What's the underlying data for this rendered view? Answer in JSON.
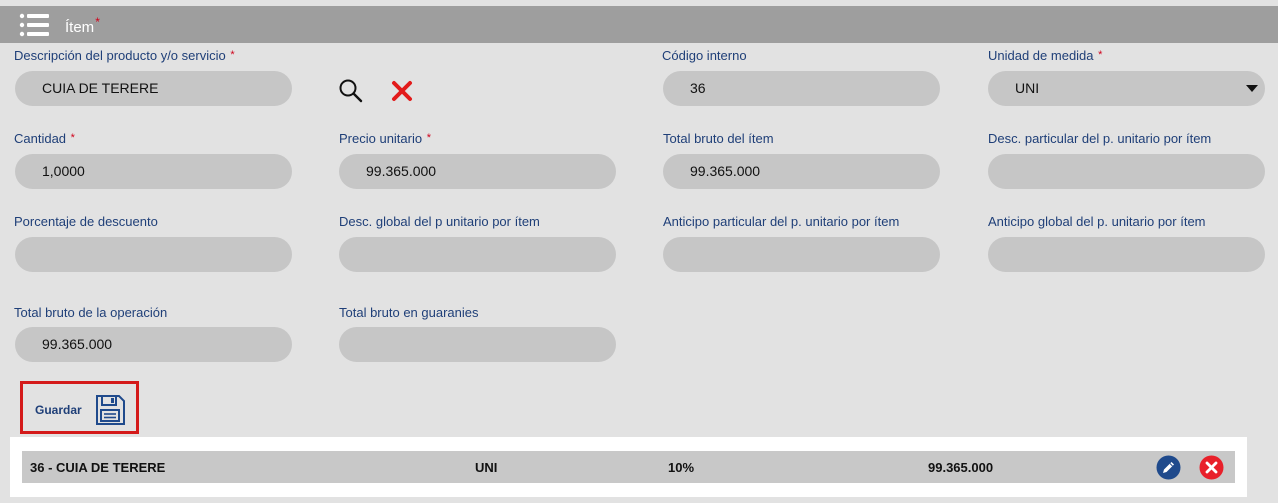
{
  "header": {
    "title": "Ítem",
    "required_mark": "*"
  },
  "fields": {
    "descripcion": {
      "label": "Descripción del producto y/o servicio",
      "required_mark": "*",
      "value": "CUIA DE TERERE"
    },
    "codigo": {
      "label": "Código interno",
      "value": "36"
    },
    "unidad": {
      "label": "Unidad de medida",
      "required_mark": "*",
      "value": "UNI"
    },
    "cantidad": {
      "label": "Cantidad",
      "required_mark": "*",
      "value": "1,0000"
    },
    "precio": {
      "label": "Precio unitario",
      "required_mark": "*",
      "value": "99.365.000"
    },
    "total_item": {
      "label": "Total bruto del ítem",
      "value": "99.365.000"
    },
    "desc_particular": {
      "label": "Desc. particular del p. unitario por ítem",
      "value": ""
    },
    "porcentaje": {
      "label": "Porcentaje de descuento",
      "value": ""
    },
    "desc_global": {
      "label": "Desc. global del p unitario por ítem",
      "value": ""
    },
    "anticipo_particular": {
      "label": "Anticipo particular del p. unitario por ítem",
      "value": ""
    },
    "anticipo_global": {
      "label": "Anticipo global del p. unitario por ítem",
      "value": ""
    },
    "total_operacion": {
      "label": "Total bruto de la operación",
      "value": "99.365.000"
    },
    "total_guaranies": {
      "label": "Total bruto en guaranies",
      "value": ""
    }
  },
  "icons": {
    "menu": "menu-icon",
    "search": "search-icon",
    "clear": "close-icon",
    "caret": "chevron-down-icon",
    "save": "floppy-disk-icon",
    "edit": "pencil-icon",
    "delete": "close-circle-icon"
  },
  "save_button": {
    "label": "Guardar"
  },
  "items_table": {
    "rows": [
      {
        "descripcion": "36 - CUIA DE TERERE",
        "unidad": "UNI",
        "porcentaje": "10%",
        "total": "99.365.000"
      }
    ]
  },
  "colors": {
    "header_bg": "#9e9e9e",
    "page_bg": "#e2e2e2",
    "input_bg": "#c6c6c6",
    "label": "#1f3f78",
    "required": "#d0021b",
    "highlight_border": "#d41a1a",
    "edit_blue": "#1f4a8c",
    "delete_red": "#e8202a"
  }
}
